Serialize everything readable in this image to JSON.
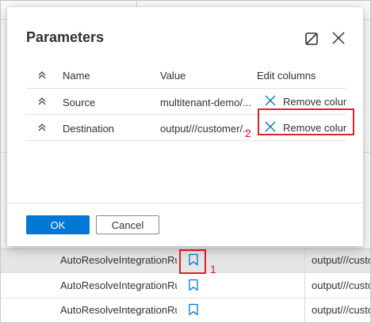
{
  "dialog": {
    "title": "Parameters",
    "columns": {
      "name": "Name",
      "value": "Value",
      "edit": "Edit columns"
    },
    "rows": [
      {
        "name": "Source",
        "value": "multitenant-demo/...",
        "action": "Remove column"
      },
      {
        "name": "Destination",
        "value": "output///customer/...",
        "action": "Remove column"
      }
    ],
    "ok_label": "OK",
    "cancel_label": "Cancel"
  },
  "background_rows": [
    {
      "name": "AutoResolveIntegrationRuntime",
      "value": "output///customer"
    },
    {
      "name": "AutoResolveIntegrationRuntime",
      "value": "output///customer"
    },
    {
      "name": "AutoResolveIntegrationRuntime",
      "value": "output///customer"
    }
  ],
  "annotations": [
    {
      "number": "1"
    },
    {
      "number": "2"
    }
  ],
  "colors": {
    "accent": "#0078d4",
    "annotation": "#e0202a",
    "icon_blue": "#0078d4",
    "selected_row": "#e6e6e6"
  },
  "icons": [
    "maximize-icon",
    "close-icon",
    "sort-icon",
    "remove-x-icon",
    "bookmark-icon"
  ]
}
